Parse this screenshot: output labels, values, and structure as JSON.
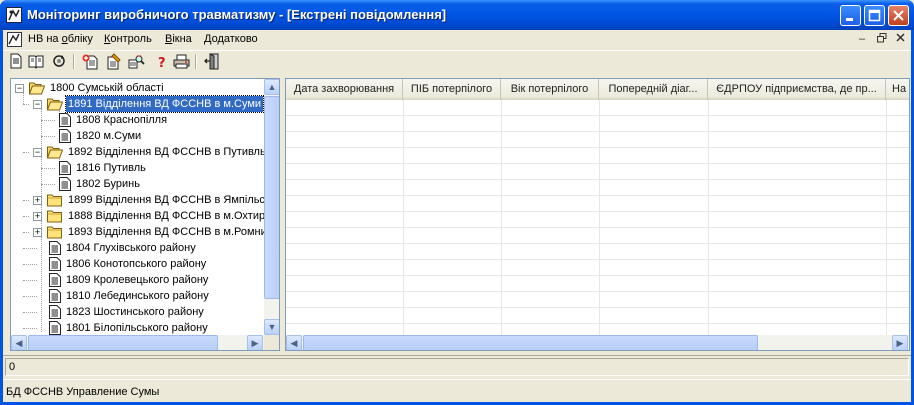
{
  "window": {
    "title": "Моніторинг виробничого травматизму - [Екстрені повідомлення]"
  },
  "menu": {
    "items": [
      {
        "label_pre": "НВ на ",
        "label_ul": "о",
        "label_post": "бліку"
      },
      {
        "label_pre": "",
        "label_ul": "К",
        "label_post": "онтроль"
      },
      {
        "label_pre": "",
        "label_ul": "В",
        "label_post": "ікна"
      },
      {
        "label_pre": "",
        "label_ul": "Д",
        "label_post": "одатково"
      }
    ]
  },
  "toolbar": {
    "icons": [
      "doc-icon",
      "book-icon",
      "refresh-icon",
      "add-doc-icon",
      "edit-doc-icon",
      "search-doc-icon",
      "help-icon",
      "print-icon",
      "exit-icon"
    ]
  },
  "tree": {
    "nodes": [
      {
        "label": "1800  Сумській області",
        "level": 0,
        "kind": "folder-open",
        "expander": "−"
      },
      {
        "label": "1891 Відділення ВД ФССНВ в м.Суми",
        "level": 1,
        "kind": "folder-open",
        "expander": "−",
        "selected": true
      },
      {
        "label": "1808 Краснопілля",
        "level": 2,
        "kind": "doc"
      },
      {
        "label": "1820 м.Суми",
        "level": 2,
        "kind": "doc"
      },
      {
        "label": "1892 Відділення ВД ФССНВ в Путивль",
        "level": 1,
        "kind": "folder-open",
        "expander": "−"
      },
      {
        "label": "1816 Путивль",
        "level": 2,
        "kind": "doc"
      },
      {
        "label": "1802 Буринь",
        "level": 2,
        "kind": "doc"
      },
      {
        "label": "1899 Відділення ВД ФССНВ в Ямпільсь",
        "level": 1,
        "kind": "folder",
        "expander": "+"
      },
      {
        "label": "1888 Відділення ВД ФССНВ в м.Охтир",
        "level": 1,
        "kind": "folder",
        "expander": "+"
      },
      {
        "label": "1893 Відділення ВД ФССНВ в м.Ромни",
        "level": 1,
        "kind": "folder",
        "expander": "+"
      },
      {
        "label": "1804 Глухівського району",
        "level": 1,
        "kind": "doc"
      },
      {
        "label": "1806 Конотопського району",
        "level": 1,
        "kind": "doc"
      },
      {
        "label": "1809 Кролевецького району",
        "level": 1,
        "kind": "doc"
      },
      {
        "label": "1810 Лебединського району",
        "level": 1,
        "kind": "doc"
      },
      {
        "label": "1823 Шостинського району",
        "level": 1,
        "kind": "doc"
      },
      {
        "label": "1801 Білопільського району",
        "level": 1,
        "kind": "doc"
      }
    ]
  },
  "grid": {
    "columns": [
      "Дата захворювання",
      "ПІБ потерпілого",
      "Вік потерпілого",
      "Попередній діаг...",
      "ЄДРПОУ підприємства, де пр...",
      "На"
    ]
  },
  "status": {
    "count": "0",
    "db": "БД ФССНВ Управление Сумы"
  },
  "colors": {
    "titlebar": "#0055E5",
    "selection": "#316AC5",
    "face": "#ECE9D8"
  }
}
